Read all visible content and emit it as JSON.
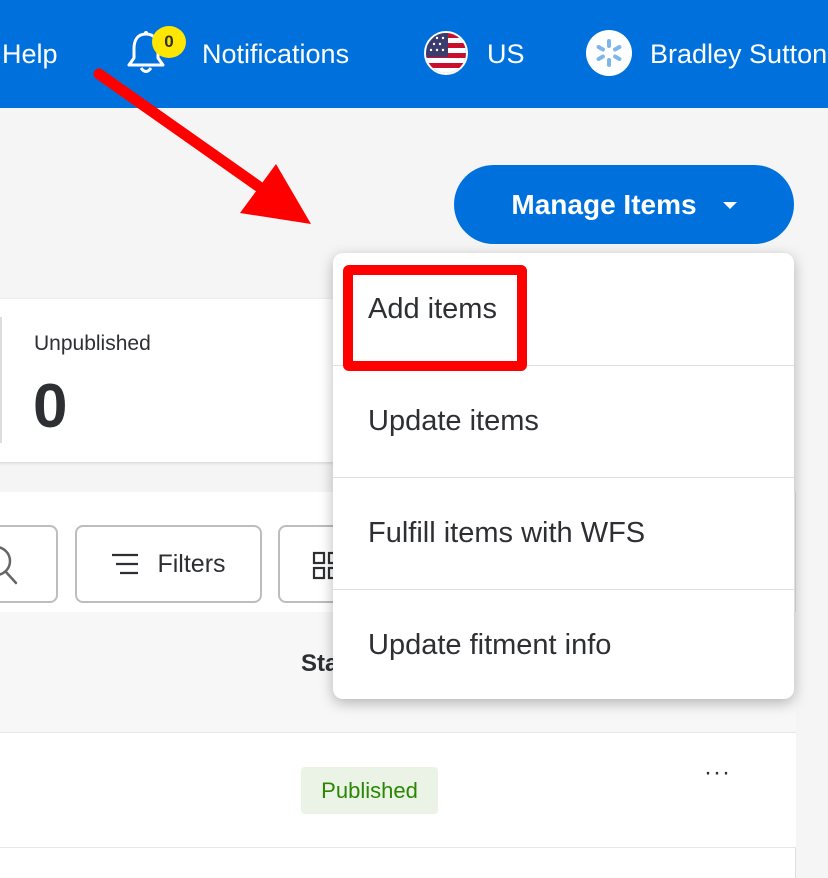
{
  "topbar": {
    "help_label": "Help",
    "notification_count": "0",
    "notifications_label": "Notifications",
    "country_label": "US",
    "user_name": "Bradley Sutton"
  },
  "manage_button": {
    "label": "Manage Items"
  },
  "stats": {
    "label": "Unpublished",
    "value": "0"
  },
  "toolbar": {
    "filters_label": "Filters"
  },
  "table": {
    "status_header": "Sta",
    "rows": [
      {
        "status": "Published",
        "actions": "···"
      }
    ]
  },
  "menu": {
    "items": [
      {
        "label": "Add items"
      },
      {
        "label": "Update items"
      },
      {
        "label": "Fulfill items with WFS"
      },
      {
        "label": "Update fitment info"
      }
    ]
  },
  "colors": {
    "brand_blue": "#0071dc",
    "badge_yellow": "#ffe600",
    "highlight_red": "#ff0000",
    "published_green": "#2a8703"
  }
}
